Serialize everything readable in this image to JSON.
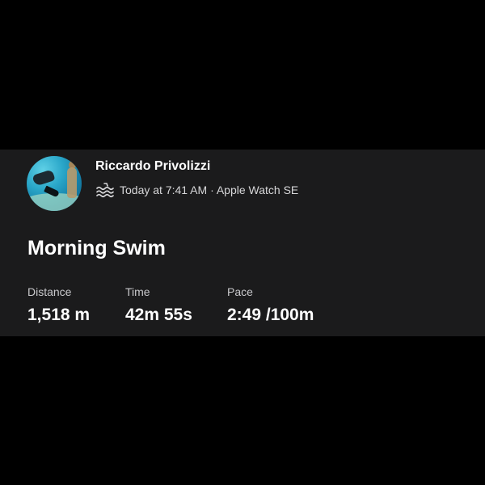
{
  "athlete": {
    "name": "Riccardo Privolizzi",
    "activity_icon": "swim-icon",
    "meta": "Today at 7:41 AM · Apple Watch SE"
  },
  "activity": {
    "title": "Morning Swim"
  },
  "stats": {
    "distance": {
      "label": "Distance",
      "value": "1,518 m"
    },
    "time": {
      "label": "Time",
      "value": "42m 55s"
    },
    "pace": {
      "label": "Pace",
      "value": "2:49 /100m"
    }
  },
  "colors": {
    "background": "#000000",
    "card": "#1b1b1c",
    "text_primary": "#ffffff",
    "text_secondary": "#c9c9cc"
  }
}
